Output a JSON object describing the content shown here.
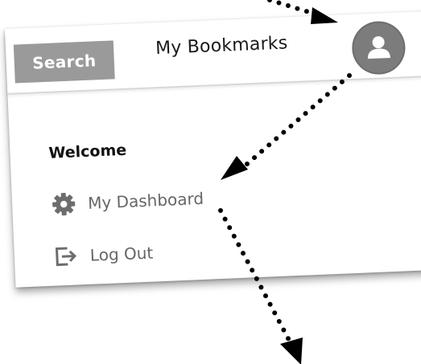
{
  "header": {
    "search_label": "Search",
    "title": "My Bookmarks",
    "avatar_icon": "user-icon"
  },
  "menu": {
    "welcome": "Welcome",
    "items": [
      {
        "label": "My Dashboard",
        "icon": "gear-icon"
      },
      {
        "label": "Log Out",
        "icon": "logout-icon"
      }
    ]
  },
  "colors": {
    "search_bg": "#9a9a9a",
    "avatar_bg": "#7c7c7c",
    "menu_text": "#666666"
  }
}
